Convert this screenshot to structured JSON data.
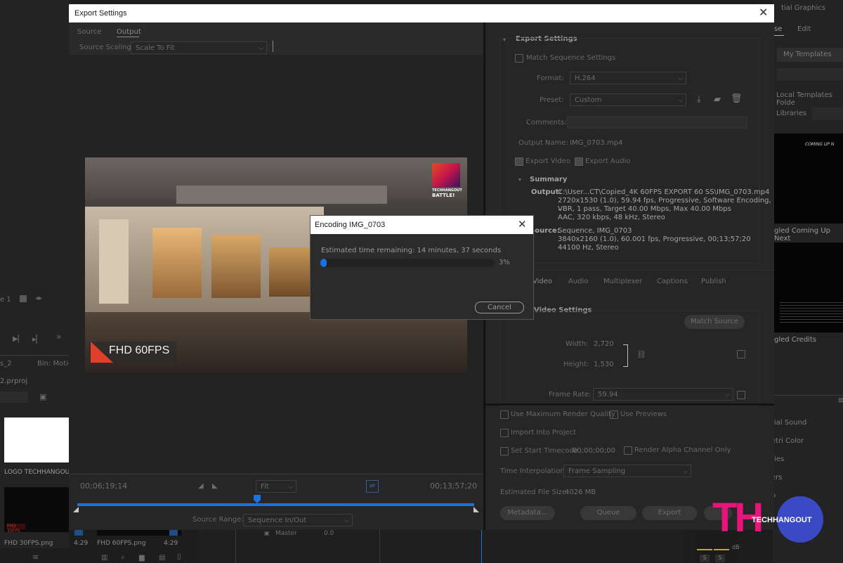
{
  "background": {
    "top_right_title": "tial Graphics",
    "top_right_tab_left": "se",
    "top_right_tab_right": "Edit",
    "my_templates": "My Templates",
    "local_templates": "Local Templates Folde",
    "libraries": "Libraries",
    "thumb1_caption": "gled Coming Up Next",
    "thumb1_text": "COMING UP N",
    "thumb2_caption": "gled Credits",
    "panel_items": [
      "tial Sound",
      "etri Color",
      "ries",
      "ers",
      "o"
    ],
    "left_bin_tab": "s_2",
    "left_bin_label": "Bin: Motio",
    "project_file": "2.prproj",
    "logo_label": "LOGO TECHHANGOUT",
    "clip1_label": "FHD 30FPS.png",
    "clip1_duration": "4:29",
    "clip2_label": "FHD 60FPS.png",
    "clip2_duration": "4:29",
    "seq_marker": "e 1",
    "master_label": "Master",
    "master_value": "0.0",
    "meter_db": "dB",
    "meter_s1": "S",
    "meter_s2": "S"
  },
  "dialog": {
    "title": "Export Settings",
    "tabs": [
      "Source",
      "Output"
    ],
    "active_tab": "Output",
    "source_scaling_label": "Source Scaling:",
    "source_scaling_value": "Scale To Fit",
    "timecode_left": "00;06;19;14",
    "timecode_right": "00;13;57;20",
    "fit_value": "Fit",
    "source_range_label": "Source Range:",
    "source_range_value": "Sequence In/Out",
    "preview_badge_text": "FHD 60FPS",
    "preview_logo_line1": "TECHHANGOUT",
    "preview_logo_line2": "BATTLE!",
    "export_settings": {
      "header": "Export Settings",
      "match_sequence": "Match Sequence Settings",
      "format_label": "Format:",
      "format_value": "H.264",
      "preset_label": "Preset:",
      "preset_value": "Custom",
      "comments_label": "Comments:",
      "output_name_label": "Output Name:",
      "output_name_value": "IMG_0703.mp4",
      "export_video": "Export Video",
      "export_audio": "Export Audio",
      "summary_header": "Summary",
      "output_label": "Output:",
      "output_lines": [
        "C:\\User...CT\\Copied_4K 60FPS EXPORT 60 SS\\IMG_0703.mp4",
        "2720x1530 (1.0), 59.94 fps, Progressive, Software Encoding, ...",
        "VBR, 1 pass, Target 40.00 Mbps, Max 40.00 Mbps",
        "AAC, 320 kbps, 48 kHz, Stereo"
      ],
      "source_label": "Source:",
      "source_lines": [
        "Sequence, IMG_0703",
        "3840x2160 (1.0), 60.001 fps, Progressive, 00;13;57;20",
        "44100 Hz, Stereo"
      ]
    },
    "settings_tabs": [
      "Video",
      "Audio",
      "Multiplexer",
      "Captions",
      "Publish"
    ],
    "video_settings": {
      "header": "Video Settings",
      "match_source": "Match Source",
      "width_label": "Width:",
      "width_value": "2,720",
      "height_label": "Height:",
      "height_value": "1,530",
      "frame_rate_label": "Frame Rate:",
      "frame_rate_value": "59.94"
    },
    "bottom": {
      "use_max_render": "Use Maximum Render Quality",
      "use_previews": "Use Previews",
      "import_into_project": "Import Into Project",
      "set_start_timecode": "Set Start Timecode",
      "start_timecode_value": "00;00;00;00",
      "render_alpha": "Render Alpha Channel Only",
      "time_interp_label": "Time Interpolation:",
      "time_interp_value": "Frame Sampling",
      "est_file_size_label": "Estimated File Size:",
      "est_file_size_value": "4026 MB",
      "metadata_btn": "Metadata...",
      "queue_btn": "Queue",
      "export_btn": "Export"
    }
  },
  "encoding": {
    "title": "Encoding IMG_0703",
    "remaining": "Estimated time remaining: 14 minutes, 37 seconds",
    "percent_text": "3%",
    "progress": 0.03,
    "cancel": "Cancel"
  },
  "watermark": {
    "letters": "TH",
    "brand": "TECHHANGOUT"
  },
  "colors": {
    "accent_blue": "#1473e6",
    "brand_pink": "#e5157a",
    "brand_blue": "#3a49c4"
  }
}
